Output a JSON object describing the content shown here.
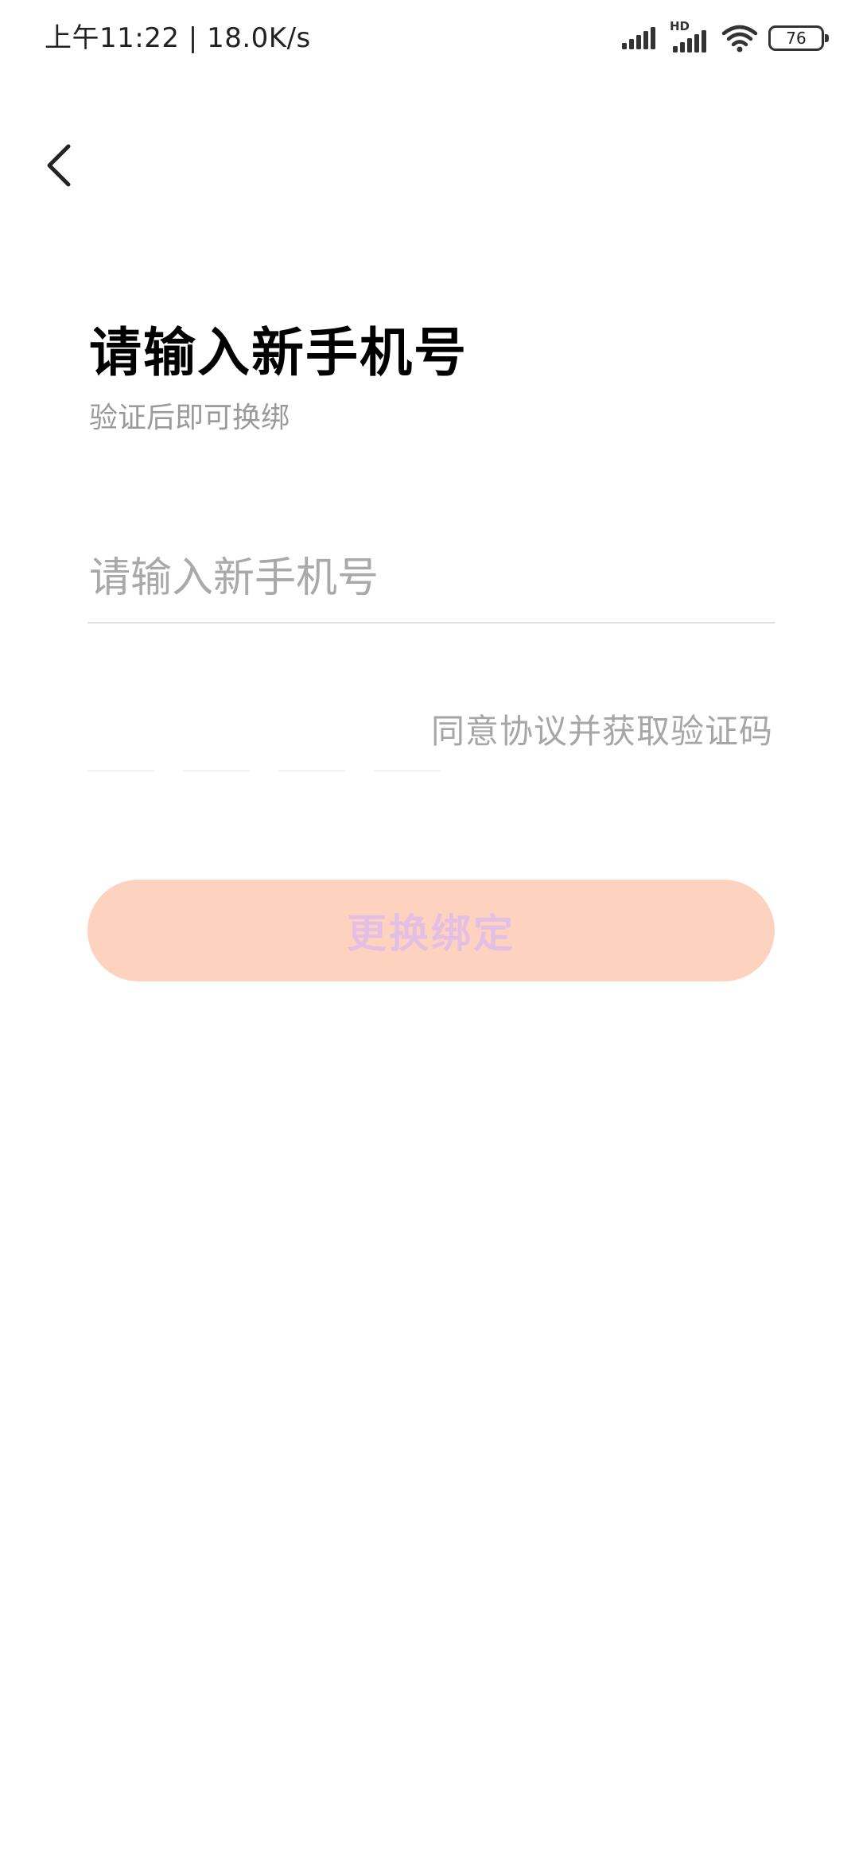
{
  "status_bar": {
    "time": "上午11:22",
    "separator": "|",
    "network_speed": "18.0K/s",
    "hd_label": "HD",
    "battery": "76",
    "icons": [
      "signal-icon",
      "hd-signal-icon",
      "wifi-icon",
      "battery-icon"
    ]
  },
  "nav": {
    "back_icon": "chevron-left-icon"
  },
  "header": {
    "title": "请输入新手机号",
    "subtitle": "验证后即可换绑"
  },
  "form": {
    "phone_placeholder": "请输入新手机号",
    "phone_value": "",
    "get_code_label": "同意协议并获取验证码",
    "code_digits": [
      "",
      "",
      "",
      ""
    ]
  },
  "actions": {
    "submit_label": "更换绑定"
  },
  "colors": {
    "button_bg": "#fdd3c0",
    "button_text": "#e4bfe3",
    "placeholder": "#a9a9a9",
    "subtitle": "#9a9a9a"
  }
}
